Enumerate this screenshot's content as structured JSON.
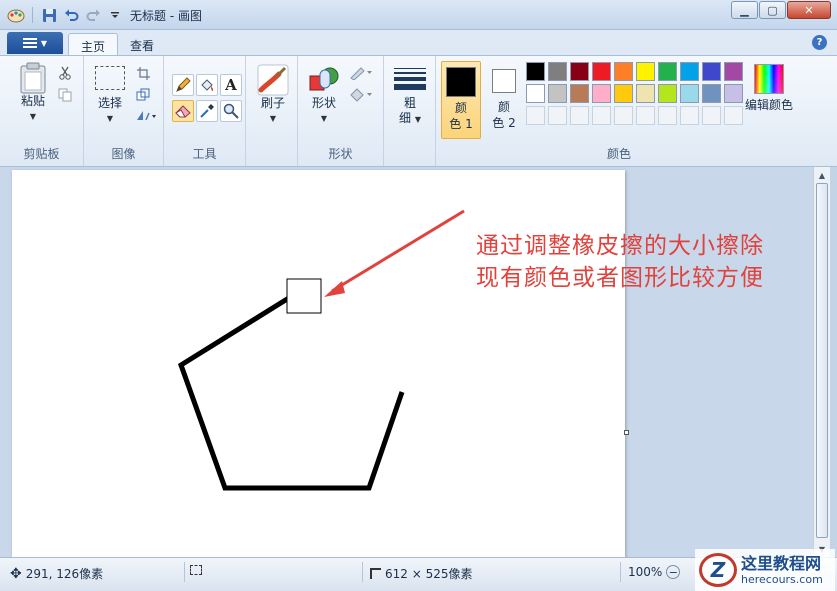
{
  "window": {
    "title": "无标题 - 画图"
  },
  "tabs": [
    {
      "label": "主页",
      "active": true
    },
    {
      "label": "查看",
      "active": false
    }
  ],
  "help_label": "?",
  "groups": {
    "clipboard": {
      "title": "剪贴板",
      "paste_label": "粘贴"
    },
    "image": {
      "title": "图像",
      "select_label": "选择"
    },
    "tools": {
      "title": "工具"
    },
    "brushes": {
      "label": "刷子"
    },
    "shapes": {
      "title": "形状",
      "label": "形状"
    },
    "size": {
      "label_line1": "粗",
      "label_line2": "细"
    },
    "colors": {
      "title": "颜色",
      "color1_line1": "颜",
      "color1_line2": "色 1",
      "color2_line1": "颜",
      "color2_line2": "色 2",
      "edit_colors": "编辑颜色",
      "color1_value": "#000000",
      "color2_value": "#ffffff",
      "palette": [
        "#000000",
        "#7f7f7f",
        "#880015",
        "#ed1c24",
        "#ff7f27",
        "#fff200",
        "#22b14c",
        "#00a2e8",
        "#3f48cc",
        "#a349a4",
        "#ffffff",
        "#c3c3c3",
        "#b97a57",
        "#ffaec9",
        "#ffc90e",
        "#efe4b0",
        "#b5e61d",
        "#99d9ea",
        "#7092be",
        "#c8bfe7"
      ]
    }
  },
  "canvas": {
    "annotation_line1": "通过调整橡皮擦的大小擦除",
    "annotation_line2": "现有颜色或者图形比较方便"
  },
  "status": {
    "cursor_position": "291, 126像素",
    "canvas_size": "612 × 525像素",
    "zoom": "100%"
  },
  "watermark": {
    "name": "这里教程网",
    "url": "herecours.com"
  }
}
